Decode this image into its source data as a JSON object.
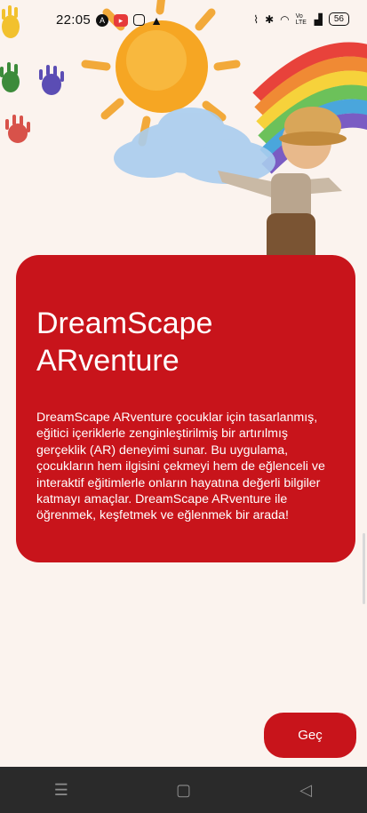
{
  "status_bar": {
    "time": "22:05",
    "left_icons": [
      "a-icon",
      "record-icon",
      "instagram-icon",
      "warning-icon"
    ],
    "right_icons": [
      "signal-icon",
      "bluetooth-icon",
      "wifi-icon",
      "volte-icon",
      "cell-signal-icon"
    ],
    "volte_label": "Vo LTE",
    "battery": "56"
  },
  "card": {
    "title": "DreamScape ARventure",
    "body": "DreamScape ARventure çocuklar için tasarlanmış, eğitici içeriklerle zenginleştirilmiş bir artırılmış gerçeklik (AR) deneyimi sunar. Bu uygulama, çocukların hem ilgisini çekmeyi hem de eğlenceli ve interaktif eğitimlerle onların hayatına değerli bilgiler katmayı amaçlar. DreamScape ARventure ile öğrenmek, keşfetmek ve eğlenmek bir arada!",
    "accent": "#c8141b"
  },
  "skip_button": {
    "label": "Geç"
  },
  "nav_bar": {
    "menu": "☰",
    "home": "▢",
    "back": "◁"
  }
}
